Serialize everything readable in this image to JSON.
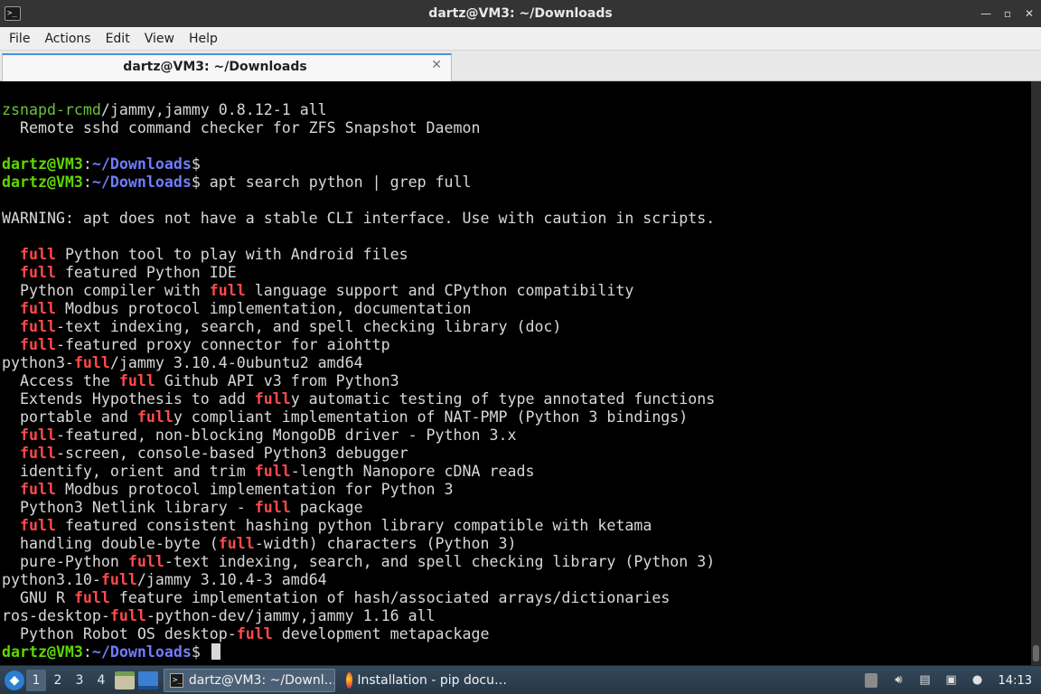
{
  "window": {
    "title": "dartz@VM3: ~/Downloads",
    "controls": [
      "—",
      "▫",
      "✕"
    ]
  },
  "menu": [
    "File",
    "Actions",
    "Edit",
    "View",
    "Help"
  ],
  "tab": {
    "label": "dartz@VM3: ~/Downloads",
    "close": "✕"
  },
  "terminal": {
    "lines": [
      [
        {
          "t": "zsnapd-rcmd",
          "c": "pkg"
        },
        {
          "t": "/jammy,jammy 0.8.12-1 all"
        }
      ],
      [
        {
          "t": "  Remote sshd command checker for ZFS Snapshot Daemon"
        }
      ],
      [
        {
          "t": ""
        }
      ],
      [
        {
          "t": "dartz@VM3",
          "c": "green"
        },
        {
          "t": ":"
        },
        {
          "t": "~/Downloads",
          "c": "blue"
        },
        {
          "t": "$"
        }
      ],
      [
        {
          "t": "dartz@VM3",
          "c": "green"
        },
        {
          "t": ":"
        },
        {
          "t": "~/Downloads",
          "c": "blue"
        },
        {
          "t": "$ apt search python | grep full"
        }
      ],
      [
        {
          "t": ""
        }
      ],
      [
        {
          "t": "WARNING: apt does not have a stable CLI interface. Use with caution in scripts."
        }
      ],
      [
        {
          "t": ""
        }
      ],
      [
        {
          "t": "  "
        },
        {
          "t": "full",
          "c": "red"
        },
        {
          "t": " Python tool to play with Android files"
        }
      ],
      [
        {
          "t": "  "
        },
        {
          "t": "full",
          "c": "red"
        },
        {
          "t": " featured Python IDE"
        }
      ],
      [
        {
          "t": "  Python compiler with "
        },
        {
          "t": "full",
          "c": "red"
        },
        {
          "t": " language support and CPython compatibility"
        }
      ],
      [
        {
          "t": "  "
        },
        {
          "t": "full",
          "c": "red"
        },
        {
          "t": " Modbus protocol implementation, documentation"
        }
      ],
      [
        {
          "t": "  "
        },
        {
          "t": "full",
          "c": "red"
        },
        {
          "t": "-text indexing, search, and spell checking library (doc)"
        }
      ],
      [
        {
          "t": "  "
        },
        {
          "t": "full",
          "c": "red"
        },
        {
          "t": "-featured proxy connector for aiohttp"
        }
      ],
      [
        {
          "t": "python3-"
        },
        {
          "t": "full",
          "c": "red"
        },
        {
          "t": "/jammy 3.10.4-0ubuntu2 amd64"
        }
      ],
      [
        {
          "t": "  Access the "
        },
        {
          "t": "full",
          "c": "red"
        },
        {
          "t": " Github API v3 from Python3"
        }
      ],
      [
        {
          "t": "  Extends Hypothesis to add "
        },
        {
          "t": "full",
          "c": "red"
        },
        {
          "t": "y automatic testing of type annotated functions"
        }
      ],
      [
        {
          "t": "  portable and "
        },
        {
          "t": "full",
          "c": "red"
        },
        {
          "t": "y compliant implementation of NAT-PMP (Python 3 bindings)"
        }
      ],
      [
        {
          "t": "  "
        },
        {
          "t": "full",
          "c": "red"
        },
        {
          "t": "-featured, non-blocking MongoDB driver - Python 3.x"
        }
      ],
      [
        {
          "t": "  "
        },
        {
          "t": "full",
          "c": "red"
        },
        {
          "t": "-screen, console-based Python3 debugger"
        }
      ],
      [
        {
          "t": "  identify, orient and trim "
        },
        {
          "t": "full",
          "c": "red"
        },
        {
          "t": "-length Nanopore cDNA reads"
        }
      ],
      [
        {
          "t": "  "
        },
        {
          "t": "full",
          "c": "red"
        },
        {
          "t": " Modbus protocol implementation for Python 3"
        }
      ],
      [
        {
          "t": "  Python3 Netlink library - "
        },
        {
          "t": "full",
          "c": "red"
        },
        {
          "t": " package"
        }
      ],
      [
        {
          "t": "  "
        },
        {
          "t": "full",
          "c": "red"
        },
        {
          "t": " featured consistent hashing python library compatible with ketama"
        }
      ],
      [
        {
          "t": "  handling double-byte ("
        },
        {
          "t": "full",
          "c": "red"
        },
        {
          "t": "-width) characters (Python 3)"
        }
      ],
      [
        {
          "t": "  pure-Python "
        },
        {
          "t": "full",
          "c": "red"
        },
        {
          "t": "-text indexing, search, and spell checking library (Python 3)"
        }
      ],
      [
        {
          "t": "python3.10-"
        },
        {
          "t": "full",
          "c": "red"
        },
        {
          "t": "/jammy 3.10.4-3 amd64"
        }
      ],
      [
        {
          "t": "  GNU R "
        },
        {
          "t": "full",
          "c": "red"
        },
        {
          "t": " feature implementation of hash/associated arrays/dictionaries"
        }
      ],
      [
        {
          "t": "ros-desktop-"
        },
        {
          "t": "full",
          "c": "red"
        },
        {
          "t": "-python-dev/jammy,jammy 1.16 all"
        }
      ],
      [
        {
          "t": "  Python Robot OS desktop-"
        },
        {
          "t": "full",
          "c": "red"
        },
        {
          "t": " development metapackage"
        }
      ],
      [
        {
          "t": "dartz@VM3",
          "c": "green"
        },
        {
          "t": ":"
        },
        {
          "t": "~/Downloads",
          "c": "blue"
        },
        {
          "t": "$ "
        }
      ]
    ]
  },
  "taskbar": {
    "desktops": [
      "1",
      "2",
      "3",
      "4"
    ],
    "active_desktop": "1",
    "tasks": [
      {
        "label": "dartz@VM3: ~/Downl…",
        "icon": "terminal-icon"
      },
      {
        "label": "Installation - pip docu…",
        "icon": "firefox-icon"
      }
    ],
    "clock": "14:13"
  }
}
